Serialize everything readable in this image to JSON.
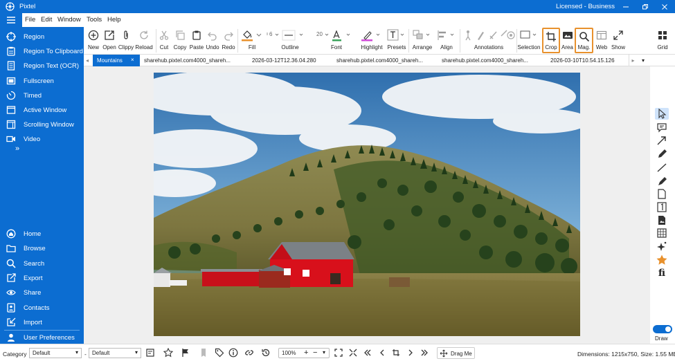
{
  "app": {
    "title": "Pixtel",
    "license": "Licensed - Business"
  },
  "menu": [
    "File",
    "Edit",
    "Window",
    "Tools",
    "Help"
  ],
  "sidebar": {
    "capture_items": [
      {
        "label": "Region",
        "icon": "crosshair-icon"
      },
      {
        "label": "Region To Clipboard",
        "icon": "clipboard-icon"
      },
      {
        "label": "Region Text (OCR)",
        "icon": "document-text-icon"
      },
      {
        "label": "Fullscreen",
        "icon": "fullscreen-icon"
      },
      {
        "label": "Timed",
        "icon": "timer-icon"
      },
      {
        "label": "Active Window",
        "icon": "window-icon"
      },
      {
        "label": "Scrolling Window",
        "icon": "scroll-window-icon"
      },
      {
        "label": "Video",
        "icon": "video-icon"
      }
    ],
    "more": "»",
    "nav_items": [
      {
        "label": "Home",
        "icon": "home-icon"
      },
      {
        "label": "Browse",
        "icon": "folder-icon"
      },
      {
        "label": "Search",
        "icon": "search-icon"
      },
      {
        "label": "Export",
        "icon": "export-icon"
      },
      {
        "label": "Share",
        "icon": "share-icon"
      },
      {
        "label": "Contacts",
        "icon": "contacts-icon"
      },
      {
        "label": "Import",
        "icon": "import-icon"
      },
      {
        "label": "User Preferences",
        "icon": "user-icon"
      }
    ]
  },
  "ribbon": {
    "new": "New",
    "open": "Open",
    "clippy": "Clippy",
    "reload": "Reload",
    "cut": "Cut",
    "copy": "Copy",
    "paste": "Paste",
    "undo": "Undo",
    "redo": "Redo",
    "fill": "Fill",
    "outline": "Outline",
    "outline_width": "6",
    "font": "Font",
    "font_size": "20",
    "highlight": "Highlight",
    "presets": "Presets",
    "arrange": "Arrange",
    "align": "Align",
    "annotations": "Annotations",
    "selection": "Selection",
    "crop": "Crop",
    "area": "Area",
    "mag": "Mag.",
    "web": "Web",
    "show": "Show",
    "grid": "Grid"
  },
  "tabs": [
    {
      "label": "Mountains"
    },
    {
      "label": "sharehub.pixtel.com4000_shareh..."
    },
    {
      "label": "2026-03-12T12.36.04.280"
    },
    {
      "label": "sharehub.pixtel.com4000_shareh..."
    },
    {
      "label": "sharehub.pixtel.com4000_shareh..."
    },
    {
      "label": "2026-03-10T10.54.15.126"
    }
  ],
  "tab_close": "×",
  "right_tools": {
    "draw_label": "Draw",
    "text_tool": "fi"
  },
  "status": {
    "category_label": "Category",
    "category_value": "Default",
    "sep": "-",
    "sub_value": "Default",
    "zoom": "100%",
    "drag": "Drag Me",
    "dimensions": "Dimensions: 1215x750, Size: 1.55 MB"
  },
  "colors": {
    "accent": "#0c6dd1",
    "highlight": "#e8912d",
    "fill_bar": "#e8912d",
    "font_bar": "#3aa35b",
    "highlight_bar": "#d04bd8"
  }
}
